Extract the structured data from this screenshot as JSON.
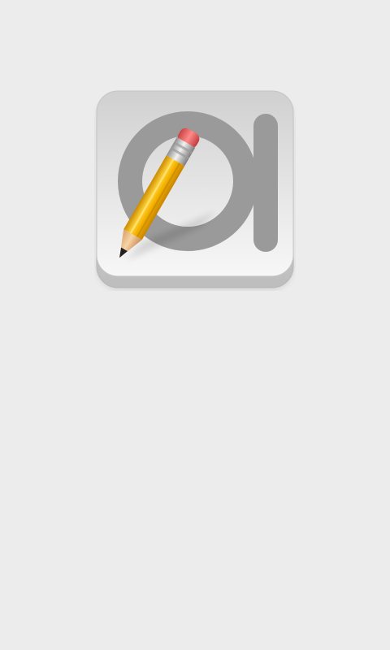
{
  "screen": {
    "type": "splash",
    "background_color": "#ececec"
  },
  "app_icon": {
    "icon_name": "oi-notepad-pencil-icon",
    "glyph_color": "#9a9a9a",
    "tile_color": "#e4e4e4",
    "pencil_body_color": "#f4b400",
    "pencil_eraser_color": "#e85a5a"
  }
}
